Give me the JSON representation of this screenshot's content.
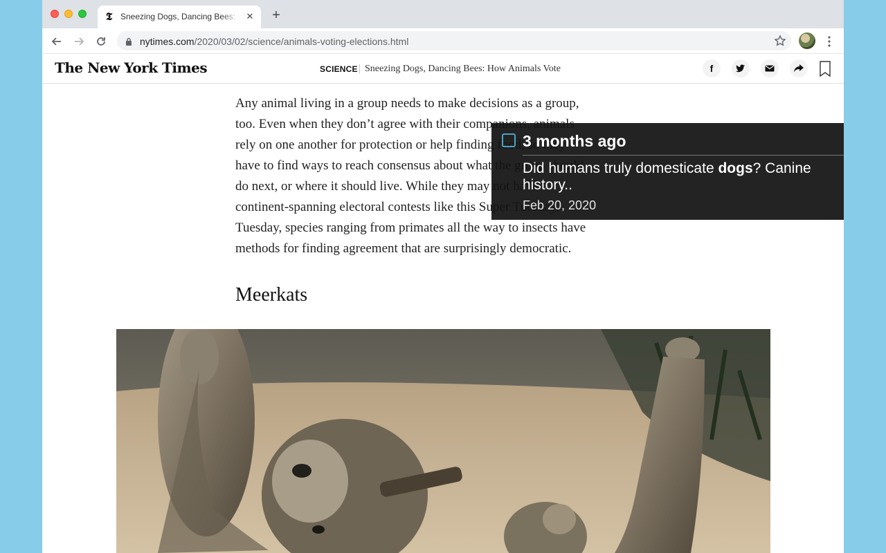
{
  "browser": {
    "tab_title": "Sneezing Dogs, Dancing Bees: How Animals Vote",
    "tab_favicon": "𝕿",
    "tab_close": "✕",
    "new_tab": "+",
    "url_domain": "nytimes.com",
    "url_path": "/2020/03/02/science/animals-voting-elections.html",
    "icons": [
      "back-arrow-icon",
      "forward-arrow-icon",
      "reload-icon",
      "lock-icon",
      "star-icon",
      "avatar",
      "kebab-menu-icon"
    ]
  },
  "site": {
    "logo": "The New York Times",
    "section": "SCIENCE",
    "headline": "Sneezing Dogs, Dancing Bees: How Animals Vote",
    "share_icons": [
      "facebook-icon",
      "twitter-icon",
      "email-icon",
      "share-arrow-icon",
      "bookmark-icon"
    ],
    "share_glyphs": {
      "facebook": "f"
    }
  },
  "article": {
    "lines": [
      "Any animal living in a group needs to make decisions as a group,",
      "too. Even when they don’t agree with their companions, animals",
      "rely on one another for protection or help finding food, so they",
      "have to find ways to reach consensus about what the group should",
      "do next, or where it should live. While they may not have",
      "continent-spanning electoral contests like this Super Tuesday,",
      "Tuesday, species ranging from primates all the way to insects have",
      "methods for finding agreement that are surprisingly democratic."
    ],
    "subhead": "Meerkats",
    "photo_alt": "meerkats photo"
  },
  "popup": {
    "when": "3 months ago",
    "title_before": "Did humans truly domesticate ",
    "title_bold": "dogs",
    "title_after": "? Canine history..",
    "date": "Feb 20, 2020",
    "accent": "#4aa6c9"
  }
}
